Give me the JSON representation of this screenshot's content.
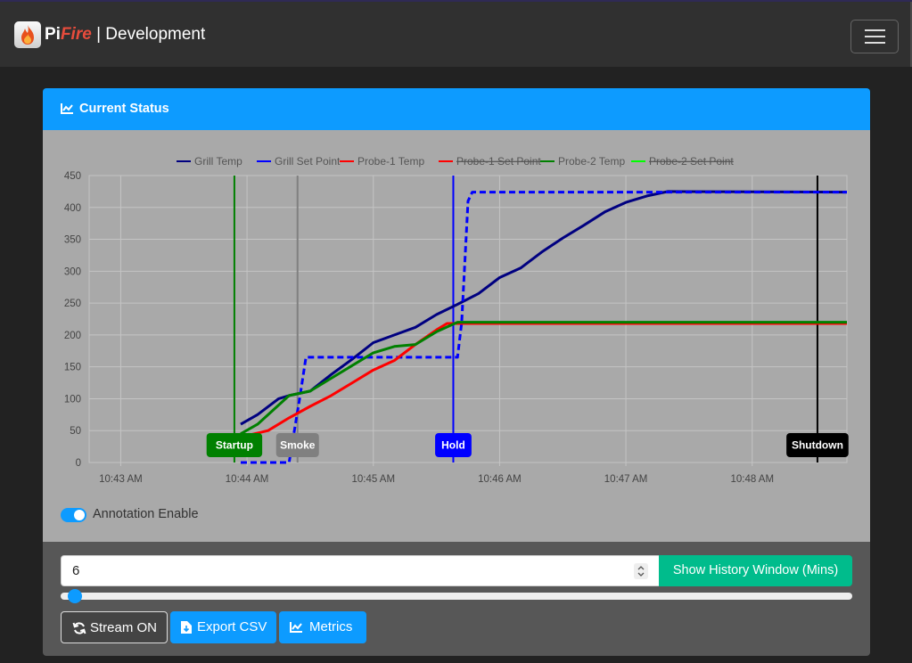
{
  "navbar": {
    "brand_pi": "Pi",
    "brand_fire": "Fire",
    "brand_rest": " | Development",
    "logo_icon": "flame-icon",
    "menu_icon": "hamburger-menu-icon"
  },
  "card": {
    "title": "Current Status",
    "title_icon": "line-chart-icon"
  },
  "chart_data": {
    "type": "line",
    "ylim": [
      0,
      450
    ],
    "yticks": [
      0,
      50,
      100,
      150,
      200,
      250,
      300,
      350,
      400,
      450
    ],
    "xticks": [
      "10:43 AM",
      "10:44 AM",
      "10:45 AM",
      "10:46 AM",
      "10:47 AM",
      "10:48 AM"
    ],
    "xlim": [
      "10:42:45",
      "10:48:45"
    ],
    "grid": true,
    "legend_position": "top",
    "legend": [
      {
        "name": "Grill Temp",
        "color": "#000080",
        "hidden": false,
        "dashed": false
      },
      {
        "name": "Grill Set Point",
        "color": "#0000ff",
        "hidden": false,
        "dashed": true
      },
      {
        "name": "Probe-1 Temp",
        "color": "#ff0000",
        "hidden": false,
        "dashed": false
      },
      {
        "name": "Probe-1 Set Point",
        "color": "#ff0000",
        "hidden": true,
        "dashed": true
      },
      {
        "name": "Probe-2 Temp",
        "color": "#008000",
        "hidden": false,
        "dashed": false
      },
      {
        "name": "Probe-2 Set Point",
        "color": "#00ff00",
        "hidden": true,
        "dashed": true
      }
    ],
    "series": [
      {
        "name": "Grill Temp",
        "color": "#000080",
        "points": [
          [
            "10:43:57",
            60
          ],
          [
            "10:44:05",
            75
          ],
          [
            "10:44:15",
            100
          ],
          [
            "10:44:20",
            105
          ],
          [
            "10:44:30",
            112
          ],
          [
            "10:44:40",
            138
          ],
          [
            "10:44:50",
            162
          ],
          [
            "10:45:00",
            188
          ],
          [
            "10:45:10",
            200
          ],
          [
            "10:45:20",
            212
          ],
          [
            "10:45:30",
            232
          ],
          [
            "10:45:40",
            248
          ],
          [
            "10:45:50",
            265
          ],
          [
            "10:46:00",
            290
          ],
          [
            "10:46:10",
            305
          ],
          [
            "10:46:20",
            330
          ],
          [
            "10:46:30",
            352
          ],
          [
            "10:46:40",
            372
          ],
          [
            "10:46:50",
            393
          ],
          [
            "10:47:00",
            408
          ],
          [
            "10:47:10",
            418
          ],
          [
            "10:47:20",
            425
          ],
          [
            "10:48:45",
            424
          ]
        ]
      },
      {
        "name": "Grill Set Point",
        "color": "#0000ff",
        "points": [
          [
            "10:43:57",
            0
          ],
          [
            "10:44:20",
            0
          ],
          [
            "10:44:25",
            100
          ],
          [
            "10:44:28",
            165
          ],
          [
            "10:45:40",
            165
          ],
          [
            "10:45:42",
            220
          ],
          [
            "10:45:45",
            410
          ],
          [
            "10:45:47",
            424
          ],
          [
            "10:48:45",
            424
          ]
        ]
      },
      {
        "name": "Probe-1 Temp",
        "color": "#ff0000",
        "points": [
          [
            "10:43:57",
            40
          ],
          [
            "10:44:10",
            50
          ],
          [
            "10:44:20",
            70
          ],
          [
            "10:44:30",
            88
          ],
          [
            "10:44:40",
            105
          ],
          [
            "10:44:50",
            125
          ],
          [
            "10:45:00",
            145
          ],
          [
            "10:45:10",
            160
          ],
          [
            "10:45:20",
            185
          ],
          [
            "10:45:30",
            208
          ],
          [
            "10:45:35",
            218
          ],
          [
            "10:48:45",
            218
          ]
        ]
      },
      {
        "name": "Probe-2 Temp",
        "color": "#008000",
        "points": [
          [
            "10:43:57",
            45
          ],
          [
            "10:44:05",
            60
          ],
          [
            "10:44:15",
            90
          ],
          [
            "10:44:20",
            105
          ],
          [
            "10:44:30",
            112
          ],
          [
            "10:44:40",
            132
          ],
          [
            "10:44:50",
            152
          ],
          [
            "10:45:00",
            172
          ],
          [
            "10:45:10",
            182
          ],
          [
            "10:45:20",
            185
          ],
          [
            "10:45:30",
            205
          ],
          [
            "10:45:40",
            220
          ],
          [
            "10:48:45",
            220
          ]
        ]
      }
    ],
    "annotations": [
      {
        "label": "Startup",
        "time": "10:43:54",
        "color": "#008000"
      },
      {
        "label": "Smoke",
        "time": "10:44:24",
        "color": "#808080"
      },
      {
        "label": "Hold",
        "time": "10:45:38",
        "color": "#0000ff"
      },
      {
        "label": "Shutdown",
        "time": "10:48:31",
        "color": "#000000"
      }
    ]
  },
  "annotation": {
    "label": "Annotation Enable",
    "enabled": true
  },
  "history": {
    "value": "6",
    "button_label": "Show History Window (Mins)",
    "slider_value": "6"
  },
  "buttons": {
    "stream_label": "Stream ON",
    "stream_icon": "refresh-icon",
    "export_label": "Export CSV",
    "export_icon": "file-download-icon",
    "metrics_label": "Metrics",
    "metrics_icon": "line-chart-icon"
  },
  "colors": {
    "accent": "#0d9bff",
    "success": "#00bc8c",
    "chart_bg": "#a9a9a9"
  }
}
